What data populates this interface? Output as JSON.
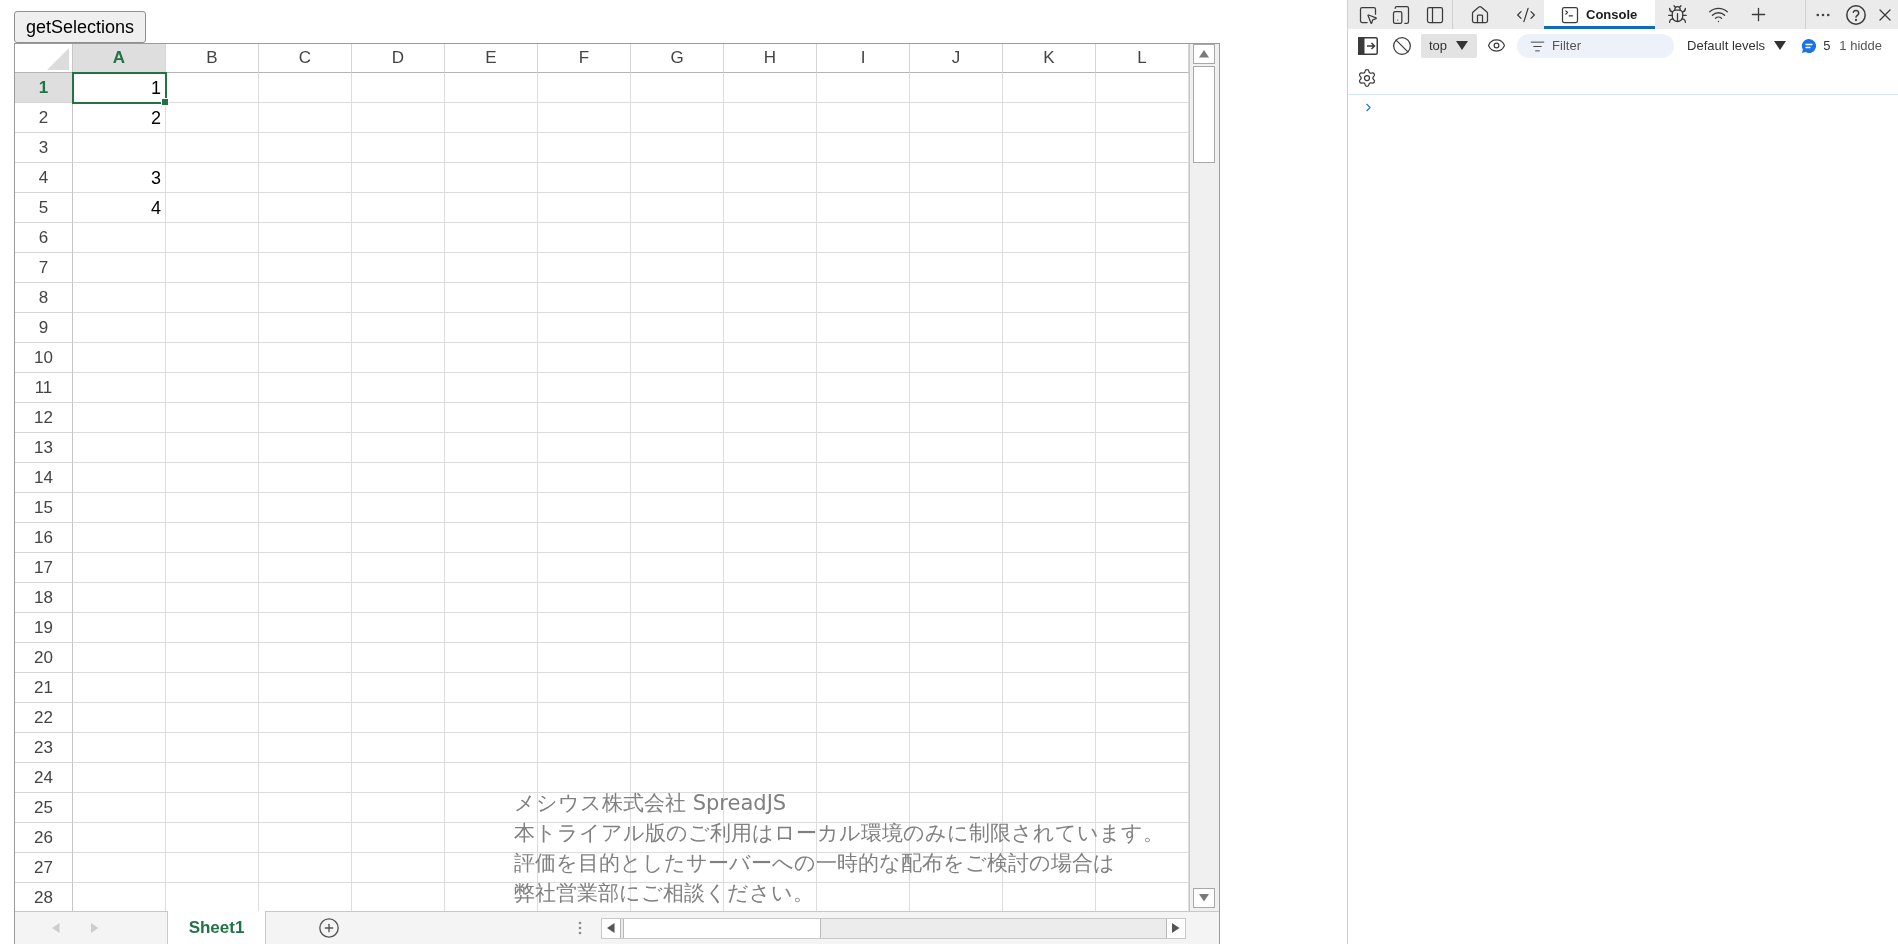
{
  "page": {
    "button": {
      "label": "getSelections"
    }
  },
  "spreadsheet": {
    "columns": [
      {
        "label": "A",
        "selected": true
      },
      {
        "label": "B",
        "selected": false
      },
      {
        "label": "C",
        "selected": false
      },
      {
        "label": "D",
        "selected": false
      },
      {
        "label": "E",
        "selected": false
      },
      {
        "label": "F",
        "selected": false
      },
      {
        "label": "G",
        "selected": false
      },
      {
        "label": "H",
        "selected": false
      },
      {
        "label": "I",
        "selected": false
      },
      {
        "label": "J",
        "selected": false
      },
      {
        "label": "K",
        "selected": false
      },
      {
        "label": "L",
        "selected": false
      }
    ],
    "rows": [
      {
        "label": "1",
        "selected": true,
        "cells": [
          {
            "text": "1",
            "active": true
          }
        ]
      },
      {
        "label": "2",
        "selected": false,
        "cells": [
          {
            "text": "2",
            "active": false
          }
        ]
      },
      {
        "label": "3",
        "selected": false
      },
      {
        "label": "4",
        "selected": false,
        "cells": [
          {
            "text": "3",
            "active": false
          }
        ]
      },
      {
        "label": "5",
        "selected": false,
        "cells": [
          {
            "text": "4",
            "active": false
          }
        ]
      },
      {
        "label": "6",
        "selected": false
      },
      {
        "label": "7",
        "selected": false
      },
      {
        "label": "8",
        "selected": false
      },
      {
        "label": "9",
        "selected": false
      },
      {
        "label": "10",
        "selected": false
      },
      {
        "label": "11",
        "selected": false
      },
      {
        "label": "12",
        "selected": false
      },
      {
        "label": "13",
        "selected": false
      },
      {
        "label": "14",
        "selected": false
      },
      {
        "label": "15",
        "selected": false
      },
      {
        "label": "16",
        "selected": false
      },
      {
        "label": "17",
        "selected": false
      },
      {
        "label": "18",
        "selected": false
      },
      {
        "label": "19",
        "selected": false
      },
      {
        "label": "20",
        "selected": false
      },
      {
        "label": "21",
        "selected": false
      },
      {
        "label": "22",
        "selected": false
      },
      {
        "label": "23",
        "selected": false
      },
      {
        "label": "24",
        "selected": false
      },
      {
        "label": "25",
        "selected": false
      },
      {
        "label": "26",
        "selected": false
      },
      {
        "label": "27",
        "selected": false
      },
      {
        "label": "28",
        "selected": false
      }
    ],
    "trial_notice": [
      "メシウス株式会社 SpreadJS",
      "本トライアル版のご利用はローカル環境のみに制限されています。",
      "評価を目的としたサーバーへの一時的な配布をご検討の場合は",
      "弊社営業部にご相談ください。"
    ],
    "sheet_tabs": [
      {
        "label": "Sheet1",
        "selected": true
      }
    ]
  },
  "devtools": {
    "tabs": [
      {
        "label": "Console",
        "selected": true
      }
    ],
    "toolbar": {
      "context": "top",
      "filter": {
        "placeholder": "Filter"
      },
      "levels": "Default levels",
      "message_count": "5",
      "hidden_count": "1 hidde"
    }
  }
}
